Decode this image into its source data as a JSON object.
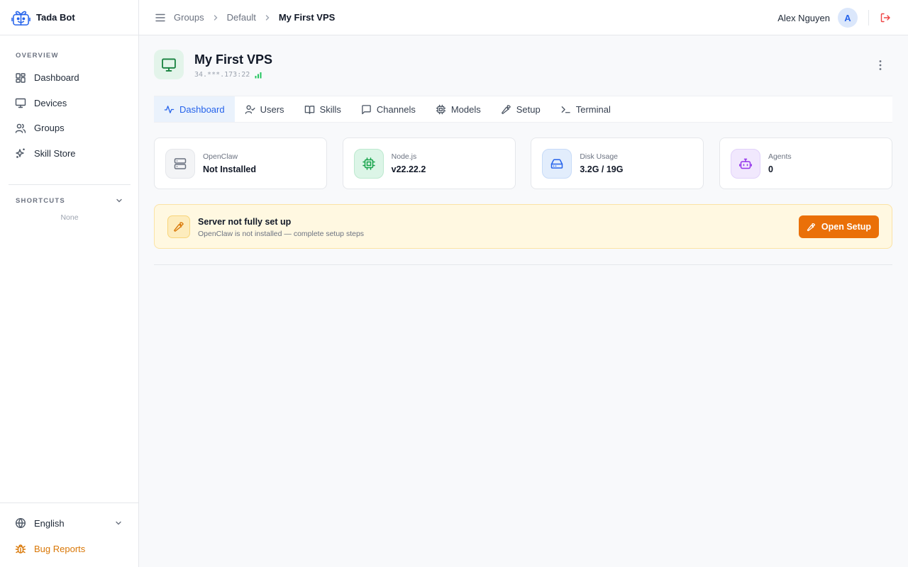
{
  "app": {
    "name": "Tada Bot",
    "colors": {
      "accent": "#2563eb",
      "success": "#15803d",
      "warning": "#d97706",
      "danger": "#ef4444",
      "button": "#ea7008"
    }
  },
  "sidebar": {
    "overview_label": "OVERVIEW",
    "items": [
      {
        "label": "Dashboard",
        "icon": "layout-grid-icon"
      },
      {
        "label": "Devices",
        "icon": "monitor-icon"
      },
      {
        "label": "Groups",
        "icon": "users-icon"
      },
      {
        "label": "Skill Store",
        "icon": "sparkles-icon"
      }
    ],
    "shortcuts_label": "SHORTCUTS",
    "shortcuts_empty": "None",
    "language": "English",
    "bug_reports": "Bug Reports"
  },
  "topbar": {
    "breadcrumb": [
      "Groups",
      "Default",
      "My First VPS"
    ],
    "user_name": "Alex Nguyen",
    "avatar_initial": "A"
  },
  "device": {
    "title": "My First VPS",
    "ip": "34.***.173:22"
  },
  "tabs": [
    {
      "label": "Dashboard",
      "icon": "activity-icon",
      "active": true
    },
    {
      "label": "Users",
      "icon": "user-check-icon"
    },
    {
      "label": "Skills",
      "icon": "book-open-icon"
    },
    {
      "label": "Channels",
      "icon": "message-square-icon"
    },
    {
      "label": "Models",
      "icon": "cpu-icon"
    },
    {
      "label": "Setup",
      "icon": "wrench-icon"
    },
    {
      "label": "Terminal",
      "icon": "terminal-icon"
    }
  ],
  "stats": [
    {
      "label": "OpenClaw",
      "value": "Not Installed",
      "icon": "server-icon"
    },
    {
      "label": "Node.js",
      "value": "v22.22.2",
      "icon": "chip-icon"
    },
    {
      "label": "Disk Usage",
      "value": "3.2G / 19G",
      "icon": "hard-drive-icon"
    },
    {
      "label": "Agents",
      "value": "0",
      "icon": "bot-icon"
    }
  ],
  "alert": {
    "title": "Server not fully set up",
    "description": "OpenClaw is not installed — complete setup steps",
    "button": "Open Setup"
  }
}
